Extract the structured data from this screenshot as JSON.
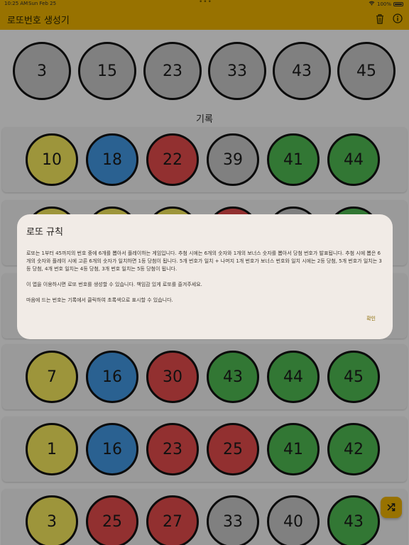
{
  "status_bar": {
    "time": "10:25 AM",
    "date": "Sun Feb 25",
    "battery": "100%"
  },
  "app_bar": {
    "title": "로또번호 생성기",
    "actions": [
      "trash-icon",
      "info-icon"
    ]
  },
  "current_numbers": [
    "3",
    "15",
    "23",
    "33",
    "43",
    "45"
  ],
  "history_label": "기록",
  "history": [
    {
      "balls": [
        {
          "n": "10",
          "color": "yellow"
        },
        {
          "n": "18",
          "color": "blue"
        },
        {
          "n": "22",
          "color": "red"
        },
        {
          "n": "39",
          "color": "gray"
        },
        {
          "n": "41",
          "color": "green"
        },
        {
          "n": "44",
          "color": "green"
        }
      ]
    },
    {
      "balls": [
        {
          "n": "",
          "color": "yellow"
        },
        {
          "n": "",
          "color": "yellow"
        },
        {
          "n": "",
          "color": "yellow"
        },
        {
          "n": "",
          "color": "red"
        },
        {
          "n": "",
          "color": "gray"
        },
        {
          "n": "",
          "color": "green"
        }
      ]
    },
    {
      "balls": [
        {
          "n": "7",
          "color": "yellow"
        },
        {
          "n": "16",
          "color": "blue"
        },
        {
          "n": "30",
          "color": "red"
        },
        {
          "n": "43",
          "color": "green"
        },
        {
          "n": "44",
          "color": "green"
        },
        {
          "n": "45",
          "color": "green"
        }
      ]
    },
    {
      "balls": [
        {
          "n": "1",
          "color": "yellow"
        },
        {
          "n": "16",
          "color": "blue"
        },
        {
          "n": "23",
          "color": "red"
        },
        {
          "n": "25",
          "color": "red"
        },
        {
          "n": "41",
          "color": "green"
        },
        {
          "n": "42",
          "color": "green"
        }
      ]
    },
    {
      "balls": [
        {
          "n": "3",
          "color": "yellow"
        },
        {
          "n": "25",
          "color": "red"
        },
        {
          "n": "27",
          "color": "red"
        },
        {
          "n": "33",
          "color": "gray"
        },
        {
          "n": "40",
          "color": "gray"
        },
        {
          "n": "43",
          "color": "green"
        }
      ]
    }
  ],
  "dialog": {
    "title": "로또 규칙",
    "p1": "로또는 1부터 45까지의 번호 중에 6개를 뽑아서 플레이하는 게임입니다. 추첨 시에는 6개의 숫자와 1개의 보너스 숫자를 뽑아서 당첨 번호가 발표됩니다. 추첨 시에 뽑은 6개의 숫자와 플레이 시에 고른 6개의 숫자가 일치하면 1등 당첨이 됩니다. 5개 번호가 일치 + 나머지 1개 번호가 보너스 번호와 일치 시에는 2등 당첨, 5개 번호가 일치는 3등 당첨, 4개 번호 일치는 4등 당첨, 3개 번호 일치는 5등 당첨이 됩니다.",
    "p2": "이 앱을 이용하시면 로또 번호를 생성할 수 있습니다. 책임감 있게 로또를 즐겨주세요.",
    "p3": "마음에 드는 번호는 기록에서 클릭하여 초록색으로 표시할 수 있습니다.",
    "ok_label": "확인"
  },
  "fab": {
    "icon": "shuffle-icon"
  },
  "colors": {
    "accent": "#e0a800",
    "yellow": "#e8dc58",
    "blue": "#3f90d6",
    "red": "#d84848",
    "green": "#4bb04d",
    "gray": "#bdbdbd"
  }
}
